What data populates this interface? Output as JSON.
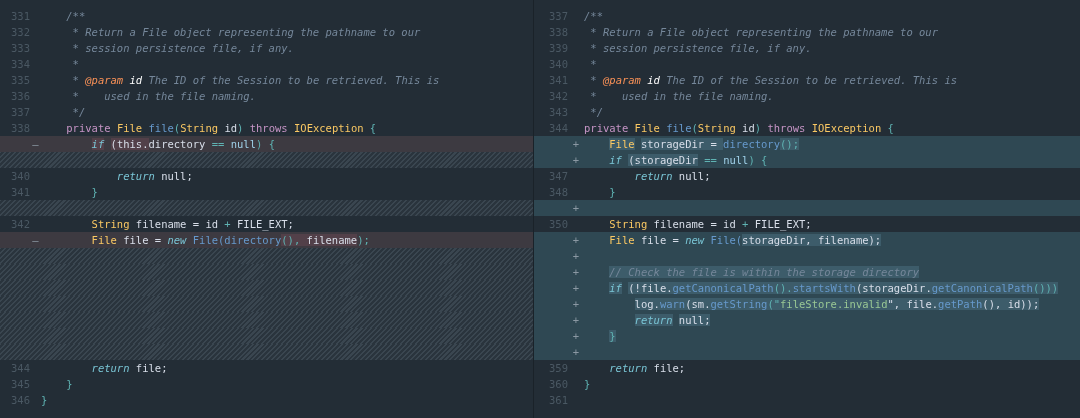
{
  "panes": [
    {
      "rows": [
        {
          "kind": "context",
          "number": "331",
          "tokens": [
            {
              "text": "    /**",
              "kind": "comment"
            }
          ]
        },
        {
          "kind": "context",
          "number": "332",
          "tokens": [
            {
              "text": "     * Return a File object representing the pathname to our",
              "kind": "comment"
            }
          ]
        },
        {
          "kind": "context",
          "number": "333",
          "tokens": [
            {
              "text": "     * session persistence file, if any.",
              "kind": "comment"
            }
          ]
        },
        {
          "kind": "context",
          "number": "334",
          "tokens": [
            {
              "text": "     *",
              "kind": "comment"
            }
          ]
        },
        {
          "kind": "context",
          "number": "335",
          "tokens": [
            {
              "text": "     *",
              "kind": "comment"
            },
            {
              "text": " @param",
              "kind": "annotation"
            },
            {
              "text": " id",
              "kind": "docname"
            },
            {
              "text": " The ID of the Session to be retrieved. This is",
              "kind": "comment"
            }
          ]
        },
        {
          "kind": "context",
          "number": "336",
          "tokens": [
            {
              "text": "     *    used in the file naming.",
              "kind": "comment"
            }
          ]
        },
        {
          "kind": "context",
          "number": "337",
          "tokens": [
            {
              "text": "     */",
              "kind": "comment"
            }
          ]
        },
        {
          "kind": "context",
          "number": "338",
          "tokens": [
            {
              "text": "    private",
              "kind": "keyword"
            },
            {
              "text": " File",
              "kind": "type"
            },
            {
              "text": " file",
              "kind": "function"
            },
            {
              "text": "(",
              "kind": "punct"
            },
            {
              "text": "String",
              "kind": "type"
            },
            {
              "text": " id",
              "kind": "plain"
            },
            {
              "text": ")",
              "kind": "punct"
            },
            {
              "text": " throws",
              "kind": "keyword"
            },
            {
              "text": " IOException",
              "kind": "type"
            },
            {
              "text": " {",
              "kind": "punct"
            }
          ]
        },
        {
          "kind": "deleted",
          "marker": "—",
          "tokens": [
            {
              "text": "        if",
              "kind": "control",
              "changed": true
            },
            {
              "text": " (this.",
              "kind": "plain",
              "changed": true
            },
            {
              "text": "directory",
              "kind": "plain",
              "changed": false
            },
            {
              "text": " ==",
              "kind": "punct"
            },
            {
              "text": " null",
              "kind": "literal"
            },
            {
              "text": ") {",
              "kind": "punct"
            }
          ]
        },
        {
          "kind": "filler"
        },
        {
          "kind": "context",
          "number": "340",
          "tokens": [
            {
              "text": "            return",
              "kind": "control"
            },
            {
              "text": " null;",
              "kind": "plain"
            }
          ]
        },
        {
          "kind": "context",
          "number": "341",
          "tokens": [
            {
              "text": "        }",
              "kind": "punct"
            }
          ]
        },
        {
          "kind": "filler"
        },
        {
          "kind": "context",
          "number": "342",
          "tokens": [
            {
              "text": "        String",
              "kind": "type"
            },
            {
              "text": " filename = id",
              "kind": "plain"
            },
            {
              "text": " +",
              "kind": "punct"
            },
            {
              "text": " FILE_EXT;",
              "kind": "plain"
            }
          ]
        },
        {
          "kind": "deleted",
          "marker": "—",
          "tokens": [
            {
              "text": "        File",
              "kind": "type"
            },
            {
              "text": " file =",
              "kind": "plain"
            },
            {
              "text": " new",
              "kind": "control"
            },
            {
              "text": " File(directory",
              "kind": "function",
              "changed": false
            },
            {
              "text": "(), ",
              "kind": "punct",
              "changed": true
            },
            {
              "text": "filename",
              "kind": "plain",
              "changed": true
            },
            {
              "text": ");",
              "kind": "punct"
            }
          ]
        },
        {
          "kind": "filler"
        },
        {
          "kind": "filler"
        },
        {
          "kind": "filler"
        },
        {
          "kind": "filler"
        },
        {
          "kind": "filler"
        },
        {
          "kind": "filler"
        },
        {
          "kind": "filler"
        },
        {
          "kind": "context",
          "number": "344",
          "tokens": [
            {
              "text": "        return",
              "kind": "control"
            },
            {
              "text": " file;",
              "kind": "plain"
            }
          ]
        },
        {
          "kind": "context",
          "number": "345",
          "tokens": [
            {
              "text": "    }",
              "kind": "punct"
            }
          ]
        },
        {
          "kind": "context",
          "number": "346",
          "tokens": [
            {
              "text": "}",
              "kind": "punct"
            }
          ]
        }
      ]
    },
    {
      "rows": [
        {
          "kind": "context",
          "number": "337",
          "tokens": [
            {
              "text": "/**",
              "kind": "comment"
            }
          ]
        },
        {
          "kind": "context",
          "number": "338",
          "tokens": [
            {
              "text": " * Return a File object representing the pathname to our",
              "kind": "comment"
            }
          ]
        },
        {
          "kind": "context",
          "number": "339",
          "tokens": [
            {
              "text": " * session persistence file, if any.",
              "kind": "comment"
            }
          ]
        },
        {
          "kind": "context",
          "number": "340",
          "tokens": [
            {
              "text": " *",
              "kind": "comment"
            }
          ]
        },
        {
          "kind": "context",
          "number": "341",
          "tokens": [
            {
              "text": " *",
              "kind": "comment"
            },
            {
              "text": " @param",
              "kind": "annotation"
            },
            {
              "text": " id",
              "kind": "docname"
            },
            {
              "text": " The ID of the Session to be retrieved. This is",
              "kind": "comment"
            }
          ]
        },
        {
          "kind": "context",
          "number": "342",
          "tokens": [
            {
              "text": " *    used in the file naming.",
              "kind": "comment"
            }
          ]
        },
        {
          "kind": "context",
          "number": "343",
          "tokens": [
            {
              "text": " */",
              "kind": "comment"
            }
          ]
        },
        {
          "kind": "context",
          "number": "344",
          "tokens": [
            {
              "text": "private",
              "kind": "keyword"
            },
            {
              "text": " File",
              "kind": "type"
            },
            {
              "text": " file",
              "kind": "function"
            },
            {
              "text": "(",
              "kind": "punct"
            },
            {
              "text": "String",
              "kind": "type"
            },
            {
              "text": " id",
              "kind": "plain"
            },
            {
              "text": ")",
              "kind": "punct"
            },
            {
              "text": " throws",
              "kind": "keyword"
            },
            {
              "text": " IOException",
              "kind": "type"
            },
            {
              "text": " {",
              "kind": "punct"
            }
          ]
        },
        {
          "kind": "added",
          "marker": "+",
          "tokens": [
            {
              "text": "    File",
              "kind": "type",
              "changed": true
            },
            {
              "text": " storageDir = ",
              "kind": "plain",
              "changed": true
            },
            {
              "text": "directory",
              "kind": "function",
              "changed": false
            },
            {
              "text": "();",
              "kind": "punct",
              "changed": true
            }
          ]
        },
        {
          "kind": "added",
          "marker": "+",
          "tokens": [
            {
              "text": "    if",
              "kind": "control",
              "changed": false
            },
            {
              "text": " (storageDir",
              "kind": "plain",
              "changed": true
            },
            {
              "text": " ==",
              "kind": "punct"
            },
            {
              "text": " null",
              "kind": "literal"
            },
            {
              "text": ") {",
              "kind": "punct"
            }
          ]
        },
        {
          "kind": "context",
          "number": "347",
          "tokens": [
            {
              "text": "        return",
              "kind": "control"
            },
            {
              "text": " null;",
              "kind": "plain"
            }
          ]
        },
        {
          "kind": "context",
          "number": "348",
          "tokens": [
            {
              "text": "    }",
              "kind": "punct"
            }
          ]
        },
        {
          "kind": "added",
          "marker": "+"
        },
        {
          "kind": "context",
          "number": "350",
          "tokens": [
            {
              "text": "    String",
              "kind": "type"
            },
            {
              "text": " filename = id",
              "kind": "plain"
            },
            {
              "text": " +",
              "kind": "punct"
            },
            {
              "text": " FILE_EXT;",
              "kind": "plain"
            }
          ]
        },
        {
          "kind": "added",
          "marker": "+",
          "tokens": [
            {
              "text": "    File",
              "kind": "type"
            },
            {
              "text": " file =",
              "kind": "plain"
            },
            {
              "text": " new",
              "kind": "control"
            },
            {
              "text": " File(",
              "kind": "function",
              "changed": false
            },
            {
              "text": "storageDir, filename);",
              "kind": "plain",
              "changed": true
            }
          ]
        },
        {
          "kind": "added",
          "marker": "+"
        },
        {
          "kind": "added",
          "marker": "+",
          "tokens": [
            {
              "text": "    // Check the file is within the storage directory",
              "kind": "comment",
              "changed": true
            }
          ]
        },
        {
          "kind": "added",
          "marker": "+",
          "tokens": [
            {
              "text": "    if",
              "kind": "control",
              "changed": true
            },
            {
              "text": " (!file.",
              "kind": "plain",
              "changed": true
            },
            {
              "text": "getCanonicalPath",
              "kind": "function",
              "changed": true
            },
            {
              "text": "().",
              "kind": "punct",
              "changed": true
            },
            {
              "text": "startsWith",
              "kind": "function",
              "changed": true
            },
            {
              "text": "(storageDir.",
              "kind": "plain",
              "changed": true
            },
            {
              "text": "getCanonicalPath",
              "kind": "function",
              "changed": true
            },
            {
              "text": "()))",
              "kind": "punct",
              "changed": true
            }
          ]
        },
        {
          "kind": "added",
          "marker": "+",
          "tokens": [
            {
              "text": "        log.",
              "kind": "plain",
              "changed": true
            },
            {
              "text": "warn",
              "kind": "function",
              "changed": true
            },
            {
              "text": "(sm.",
              "kind": "plain",
              "changed": true
            },
            {
              "text": "getString",
              "kind": "function",
              "changed": true
            },
            {
              "text": "(\"",
              "kind": "punct",
              "changed": true
            },
            {
              "text": "fileStore.invalid",
              "kind": "string",
              "changed": true
            },
            {
              "text": "\", file.",
              "kind": "plain",
              "changed": true
            },
            {
              "text": "getPath",
              "kind": "function",
              "changed": true
            },
            {
              "text": "(), id));",
              "kind": "plain",
              "changed": true
            }
          ]
        },
        {
          "kind": "added",
          "marker": "+",
          "tokens": [
            {
              "text": "        return",
              "kind": "control",
              "changed": true
            },
            {
              "text": " null;",
              "kind": "plain",
              "changed": true
            }
          ]
        },
        {
          "kind": "added",
          "marker": "+",
          "tokens": [
            {
              "text": "    }",
              "kind": "punct",
              "changed": true
            }
          ]
        },
        {
          "kind": "added",
          "marker": "+"
        },
        {
          "kind": "context",
          "number": "359",
          "tokens": [
            {
              "text": "    return",
              "kind": "control"
            },
            {
              "text": " file;",
              "kind": "plain"
            }
          ]
        },
        {
          "kind": "context",
          "number": "360",
          "tokens": [
            {
              "text": "}",
              "kind": "punct"
            }
          ]
        },
        {
          "kind": "context",
          "number": "361"
        }
      ]
    }
  ]
}
